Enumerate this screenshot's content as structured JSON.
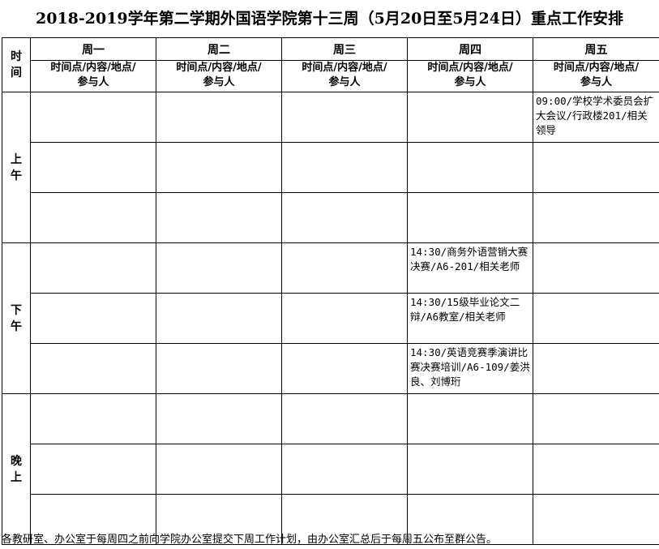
{
  "title": "2018-2019学年第二学期外国语学院第十三周（5月20日至5月24日）重点工作安排",
  "header": {
    "time_label": "时\n间",
    "days": [
      "周一",
      "周二",
      "周三",
      "周四",
      "周五"
    ],
    "subheader": "时间点/内容/地点/\n参与人"
  },
  "periods": [
    {
      "label": "上\n午",
      "slots": [
        [
          "",
          "",
          "",
          "",
          "09:00/学校学术委员会扩大会议/行政楼201/相关领导"
        ],
        [
          "",
          "",
          "",
          "",
          ""
        ],
        [
          "",
          "",
          "",
          "",
          ""
        ]
      ]
    },
    {
      "label": "下\n午",
      "slots": [
        [
          "",
          "",
          "",
          "14:30/商务外语营销大赛决赛/A6-201/相关老师",
          ""
        ],
        [
          "",
          "",
          "",
          "14:30/15级毕业论文二辩/A6教室/相关老师",
          ""
        ],
        [
          "",
          "",
          "",
          "14:30/英语竞赛季演讲比赛决赛培训/A6-109/姜洪良、刘博珩",
          ""
        ]
      ]
    },
    {
      "label": "晚\n上",
      "slots": [
        [
          "",
          "",
          "",
          "",
          ""
        ],
        [
          "",
          "",
          "",
          "",
          ""
        ],
        [
          "",
          "",
          "",
          "",
          ""
        ]
      ]
    }
  ],
  "footer": "各教研室、办公室于每周四之前向学院办公室提交下周工作计划，由办公室汇总后于每周五公布至群公告。"
}
